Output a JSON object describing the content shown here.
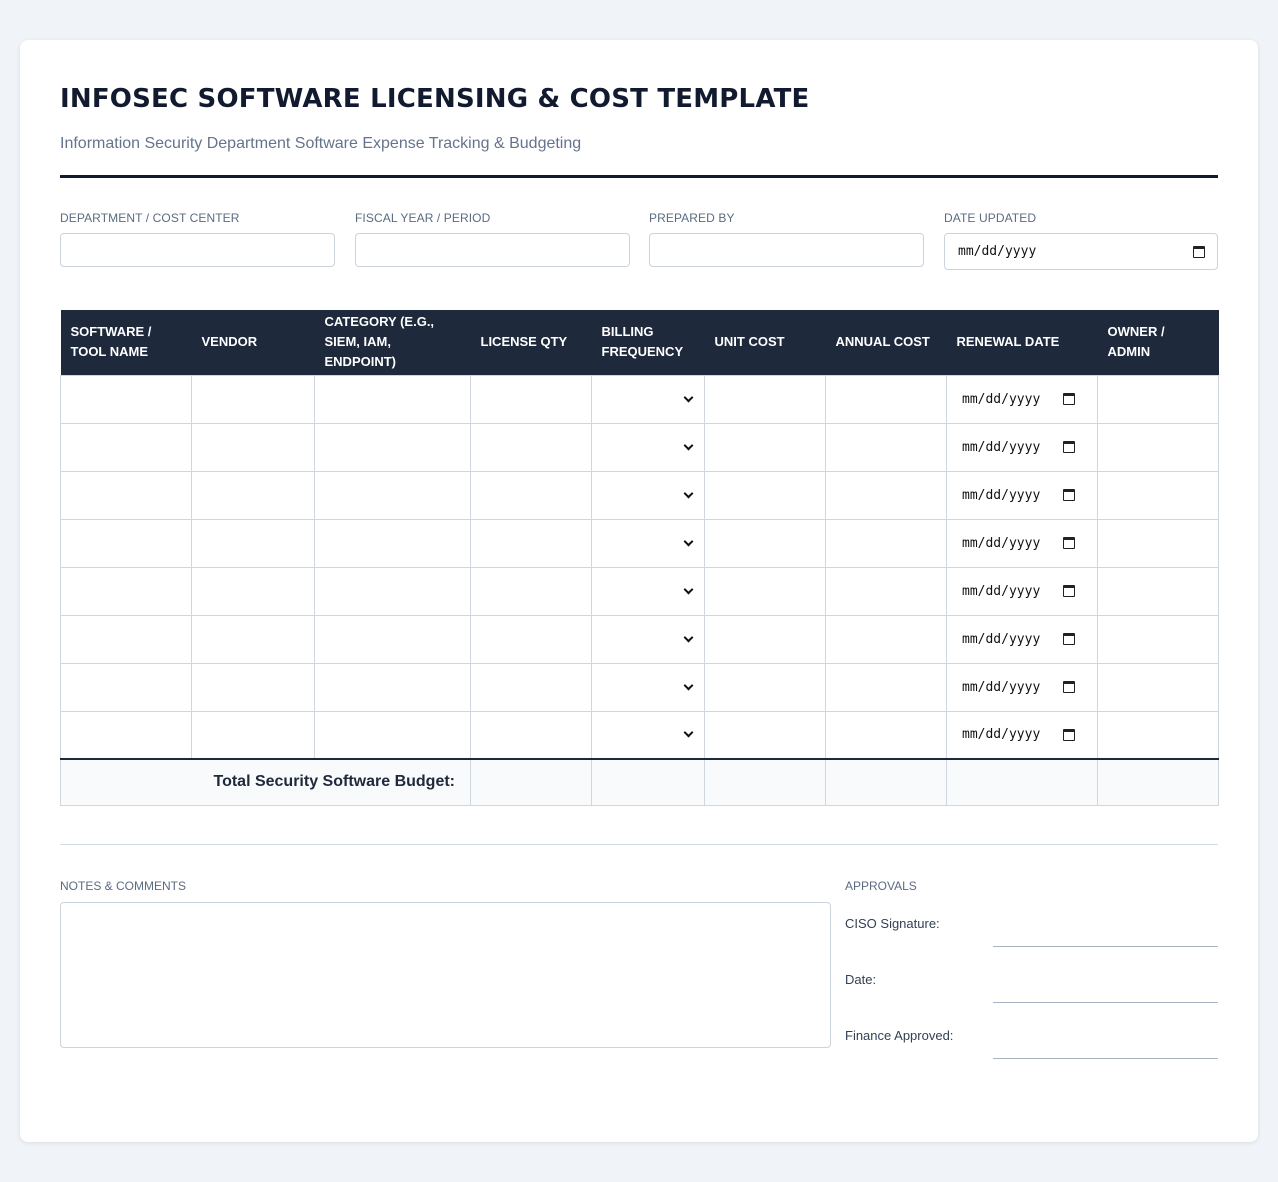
{
  "header": {
    "title": "INFOSEC SOFTWARE LICENSING & COST TEMPLATE",
    "subtitle": "Information Security Department Software Expense Tracking & Budgeting"
  },
  "meta_fields": {
    "department": {
      "label": "DEPARTMENT / COST CENTER",
      "value": ""
    },
    "fiscal_year": {
      "label": "FISCAL YEAR / PERIOD",
      "value": ""
    },
    "prepared_by": {
      "label": "PREPARED BY",
      "value": ""
    },
    "date_updated": {
      "label": "DATE UPDATED",
      "placeholder": "mm/dd/yyyy"
    }
  },
  "table": {
    "columns": [
      "SOFTWARE / TOOL NAME",
      "VENDOR",
      "CATEGORY (E.G., SIEM, IAM, ENDPOINT)",
      "LICENSE QTY",
      "BILLING FREQUENCY",
      "UNIT COST",
      "ANNUAL COST",
      "RENEWAL DATE",
      "OWNER / ADMIN"
    ],
    "date_placeholder": "mm/dd/yyyy",
    "row_count_visible": 8,
    "total_label": "Total Security Software Budget:"
  },
  "notes": {
    "label": "NOTES & COMMENTS",
    "value": ""
  },
  "approvals": {
    "title": "APPROVALS",
    "ciso_signature": "CISO Signature:",
    "date": "Date:",
    "finance_approved": "Finance Approved:"
  },
  "colors": {
    "header_bg": "#1e293b",
    "title": "#111a2e",
    "muted": "#64748b",
    "border": "#cfd6de",
    "page_bg": "#f0f3f7"
  }
}
